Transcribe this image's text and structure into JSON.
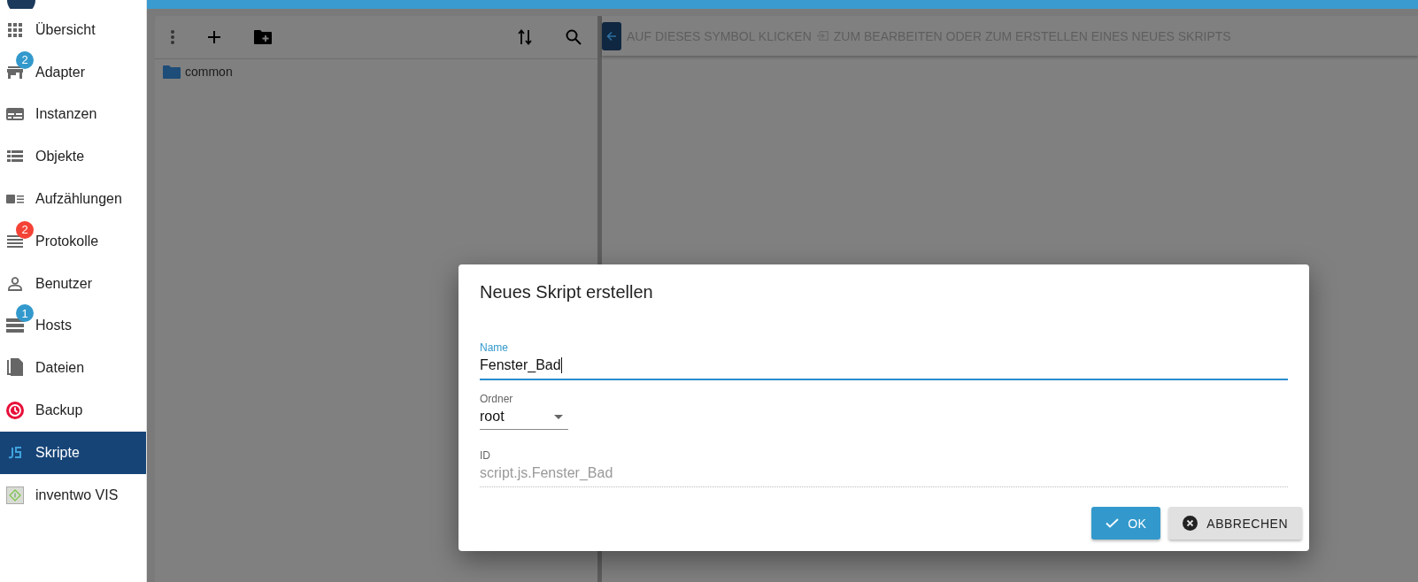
{
  "sidebar": {
    "items": [
      {
        "label": "Übersicht",
        "selected": false
      },
      {
        "label": "Adapter",
        "selected": false,
        "badge": {
          "count": "2",
          "color": "#3399cc"
        }
      },
      {
        "label": "Instanzen",
        "selected": false
      },
      {
        "label": "Objekte",
        "selected": false
      },
      {
        "label": "Aufzählungen",
        "selected": false
      },
      {
        "label": "Protokolle",
        "selected": false,
        "badge": {
          "count": "2",
          "color": "#f44336"
        }
      },
      {
        "label": "Benutzer",
        "selected": false
      },
      {
        "label": "Hosts",
        "selected": false,
        "badge": {
          "count": "1",
          "color": "#3399cc"
        }
      },
      {
        "label": "Dateien",
        "selected": false
      },
      {
        "label": "Backup",
        "selected": false
      },
      {
        "label": "Skripte",
        "selected": true
      },
      {
        "label": "inventwo VIS",
        "selected": false
      }
    ]
  },
  "tree": {
    "items": [
      {
        "label": "common",
        "kind": "folder"
      }
    ]
  },
  "editor_hint": {
    "before": "AUF DIESES SYMBOL KLICKEN",
    "after": "ZUM BEARBEITEN ODER ZUM ERSTELLEN EINES NEUES SKRIPTS"
  },
  "dialog": {
    "title": "Neues Skript erstellen",
    "name_field": {
      "label": "Name",
      "value": "Fenster_Bad"
    },
    "folder_field": {
      "label": "Ordner",
      "value": "root"
    },
    "id_field": {
      "label": "ID",
      "value": "script.js.Fenster_Bad"
    },
    "buttons": [
      {
        "label": "OK",
        "kind": "primary"
      },
      {
        "label": "ABBRECHEN",
        "kind": "cancel"
      }
    ]
  }
}
